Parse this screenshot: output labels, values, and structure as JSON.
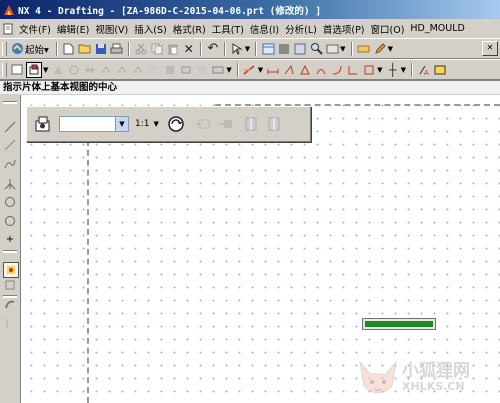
{
  "window": {
    "title": "NX 4 - Drafting - [ZA-986D-C-2015-04-06.prt (修改的) ]"
  },
  "menubar": {
    "items": [
      "文件(F)",
      "编辑(E)",
      "视图(V)",
      "插入(S)",
      "格式(R)",
      "工具(T)",
      "信息(I)",
      "分析(L)",
      "首选项(P)",
      "窗口(O)",
      "HD_MOULD"
    ]
  },
  "toolbar1": {
    "start_label": "起始▾"
  },
  "prompt": {
    "text": "指示片体上基本视图的中心"
  },
  "view_toolbar": {
    "view_combo_value": "",
    "scale_label": "1:1"
  },
  "progress": {
    "fraction": 1.0
  },
  "watermark": {
    "text": "小狐狸网",
    "url": "XHLKS.CN"
  },
  "colors": {
    "title_gradient_start": "#0a246a",
    "progress_fill": "#1f8a1f",
    "grid_dot": "#9fb4d4"
  }
}
